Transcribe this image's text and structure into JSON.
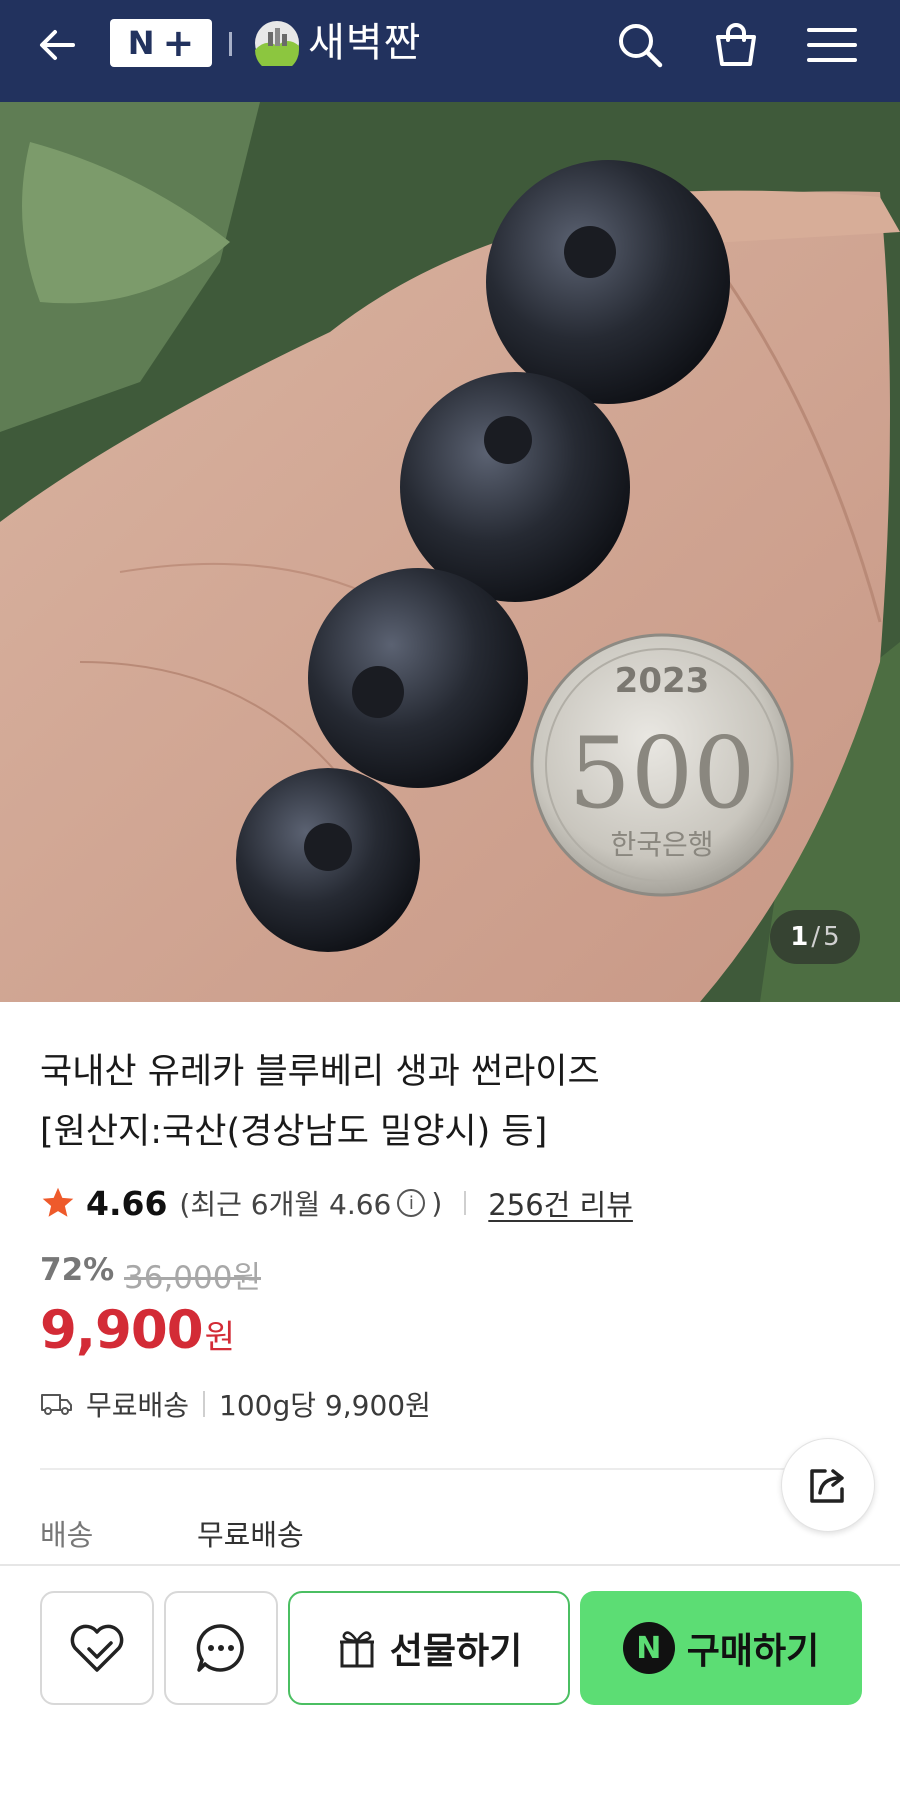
{
  "header": {
    "back_icon": "back-arrow-icon",
    "naver_plus_logo": "N+",
    "brand_name": "새벽짠",
    "search_icon": "search-icon",
    "cart_icon": "shopping-bag-icon",
    "menu_icon": "hamburger-menu-icon"
  },
  "hero": {
    "coin_year": "2023",
    "coin_value": "500",
    "coin_issuer": "한국은행",
    "counter": {
      "current": "1",
      "separator": "/",
      "total": "5"
    }
  },
  "product": {
    "title_line1": "국내산 유레카 블루베리 생과 썬라이즈",
    "title_line2": "[원산지:국산(경상남도 밀양시) 등]",
    "rating": "4.66",
    "recent_prefix": "(최근 6개월 4.66",
    "recent_suffix": ")",
    "reviews": "256건 리뷰",
    "discount": "72%",
    "original_price": "36,000원",
    "price": "9,900",
    "price_unit": "원",
    "shipping": "무료배송",
    "unit_price": "100g당 9,900원",
    "delivery_label": "배송",
    "delivery_value": "무료배송"
  },
  "bottom_bar": {
    "gift_label": "선물하기",
    "buy_label": "구매하기",
    "npay_letter": "N"
  },
  "colors": {
    "header_bg": "#22325e",
    "price_red": "#d32b36",
    "buy_green": "#5cdd74",
    "gift_border": "#4bbf62",
    "star": "#ee5a2b"
  }
}
